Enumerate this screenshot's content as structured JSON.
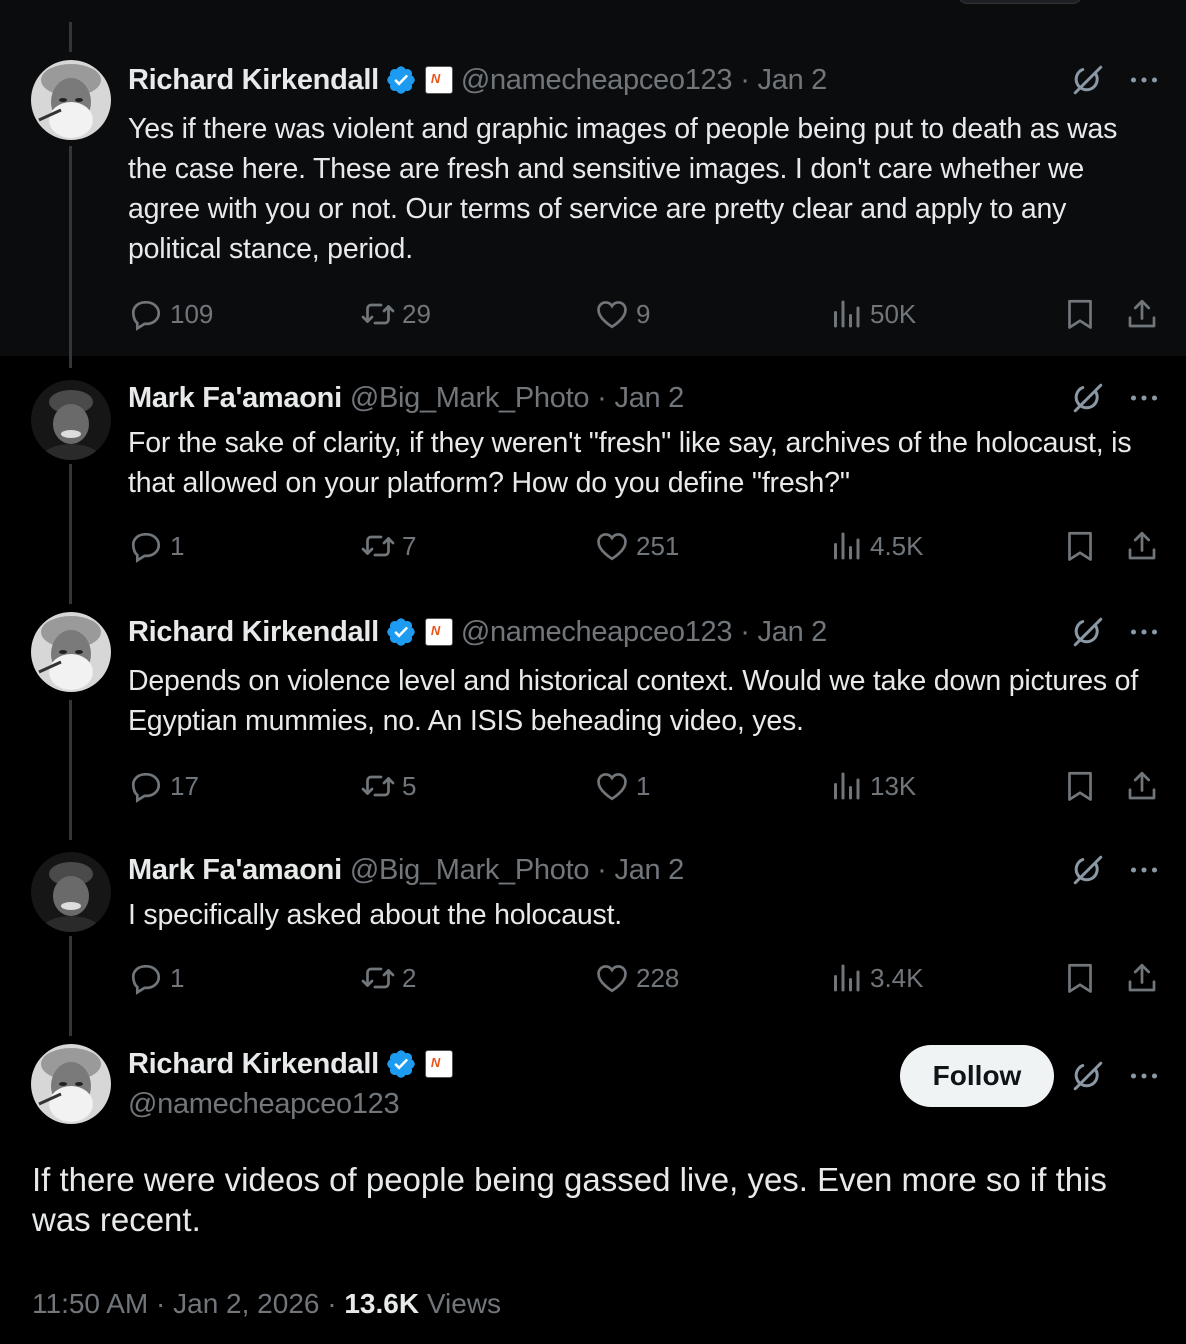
{
  "tweets": [
    {
      "name": "Richard Kirkendall",
      "handle": "@namecheapceo123",
      "date": "Jan 2",
      "verified": true,
      "affiliate": true,
      "avatar": "old-man-smoking",
      "text": "Yes if there was violent and graphic images of people being put to death as was the case here. These are fresh and sensitive images. I don't care whether we agree with you or not. Our terms of service are pretty clear and apply to any political stance, period.",
      "replies": "109",
      "reposts": "29",
      "likes": "9",
      "views": "50K"
    },
    {
      "name": "Mark Fa'amaoni",
      "handle": "@Big_Mark_Photo",
      "date": "Jan 2",
      "verified": false,
      "affiliate": false,
      "avatar": "man-with-cap",
      "text": "For the sake of clarity, if they weren't \"fresh\" like say, archives of the holocaust, is that allowed on your platform? How do you define \"fresh?\"",
      "replies": "1",
      "reposts": "7",
      "likes": "251",
      "views": "4.5K"
    },
    {
      "name": "Richard Kirkendall",
      "handle": "@namecheapceo123",
      "date": "Jan 2",
      "verified": true,
      "affiliate": true,
      "avatar": "old-man-smoking",
      "text": "Depends on violence level and historical context. Would we take down pictures of Egyptian mummies, no. An ISIS beheading video, yes.",
      "replies": "17",
      "reposts": "5",
      "likes": "1",
      "views": "13K"
    },
    {
      "name": "Mark Fa'amaoni",
      "handle": "@Big_Mark_Photo",
      "date": "Jan 2",
      "verified": false,
      "affiliate": false,
      "avatar": "man-with-cap",
      "text": "I specifically asked about the holocaust.",
      "replies": "1",
      "reposts": "2",
      "likes": "228",
      "views": "3.4K"
    }
  ],
  "main": {
    "name": "Richard Kirkendall",
    "handle": "@namecheapceo123",
    "follow_label": "Follow",
    "text": "If there were videos of people being gassed live, yes. Even more so if this was recent.",
    "time": "11:50 AM",
    "date": "Jan 2, 2026",
    "views_count": "13.6K",
    "views_label": "Views"
  },
  "separator": "·",
  "colors": {
    "background": "#000000",
    "text": "#e7e9ea",
    "muted": "#71767b",
    "verified": "#1d9bf0",
    "thread_line": "#333639"
  }
}
